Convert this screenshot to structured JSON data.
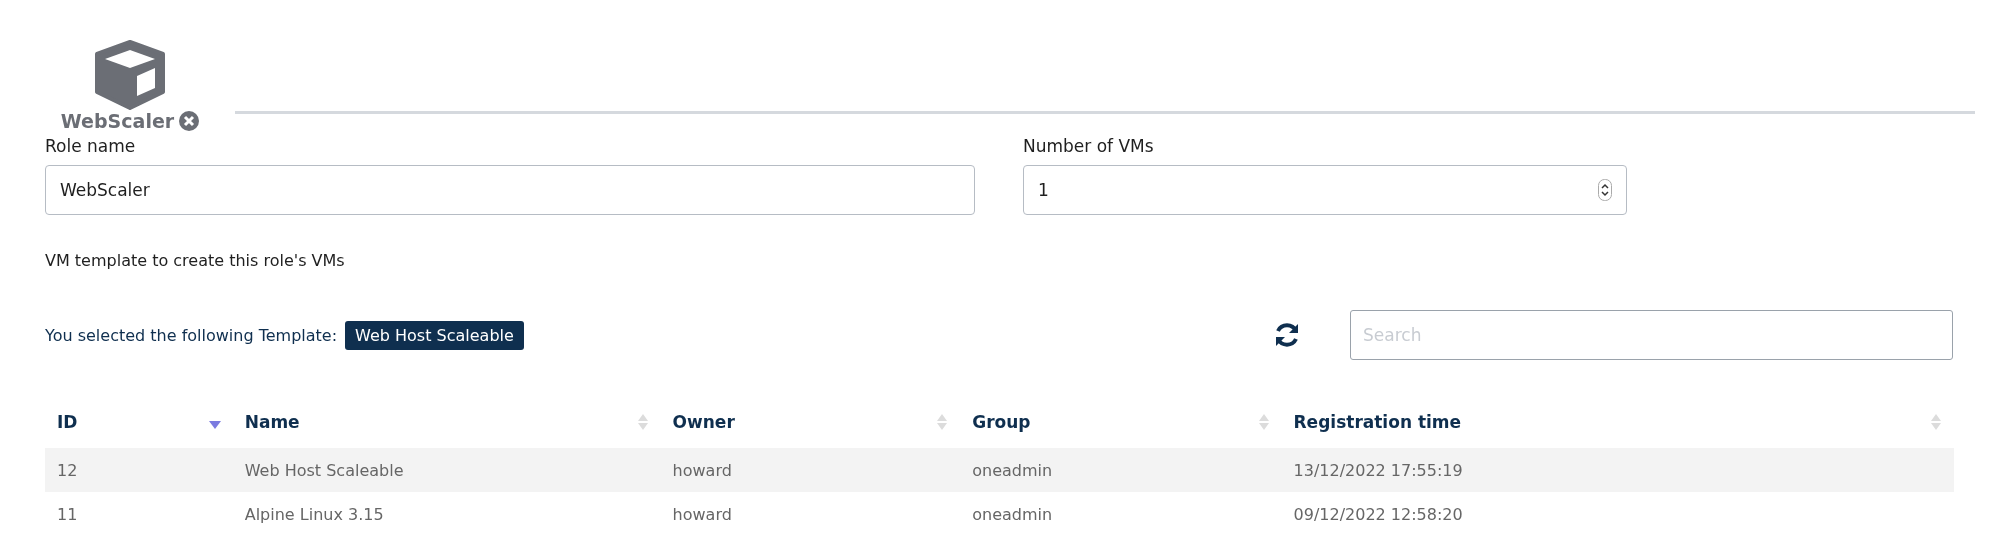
{
  "role_tab": {
    "label": "WebScaler"
  },
  "role_name": {
    "label": "Role name",
    "value": "WebScaler"
  },
  "number_of_vms": {
    "label": "Number of VMs",
    "value": "1"
  },
  "template_hint": "VM template to create this role's VMs",
  "selected_template": {
    "label": "You selected the following Template:",
    "badge": "Web Host Scaleable"
  },
  "search": {
    "placeholder": "Search"
  },
  "table": {
    "columns": [
      {
        "label": "ID",
        "sorted_descending": true
      },
      {
        "label": "Name",
        "sorted_descending": false
      },
      {
        "label": "Owner",
        "sorted_descending": false
      },
      {
        "label": "Group",
        "sorted_descending": false
      },
      {
        "label": "Registration time",
        "sorted_descending": false
      }
    ],
    "rows": [
      {
        "cells": [
          "12",
          "Web Host Scaleable",
          "howard",
          "oneadmin",
          "13/12/2022 17:55:19"
        ],
        "selected": true
      },
      {
        "cells": [
          "11",
          "Alpine Linux 3.15",
          "howard",
          "oneadmin",
          "09/12/2022 12:58:20"
        ],
        "selected": false
      }
    ]
  }
}
